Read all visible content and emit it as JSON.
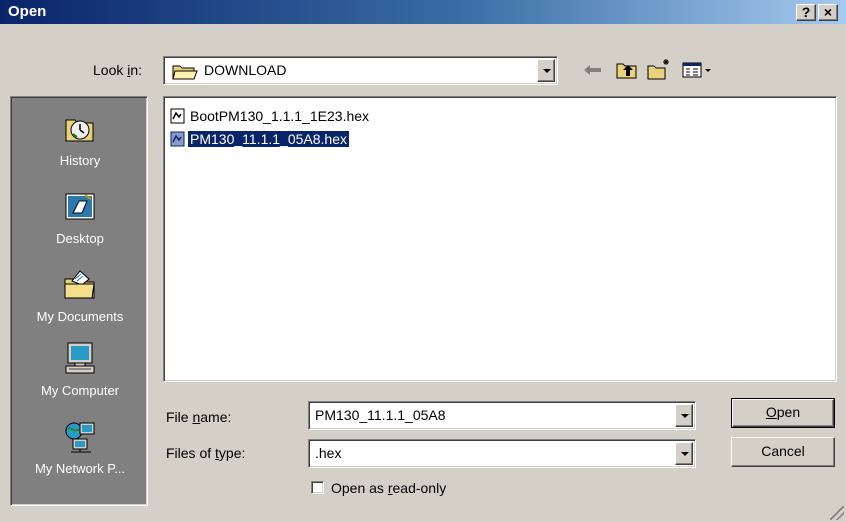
{
  "window": {
    "title": "Open",
    "help_label": "?",
    "close_label": "×"
  },
  "look_in": {
    "label_pre": "Look ",
    "label_u": "i",
    "label_post": "n:",
    "value": "DOWNLOAD"
  },
  "toolbar": {
    "icons": [
      "back-arrow-icon",
      "up-one-level-icon",
      "new-folder-icon",
      "view-menu-icon"
    ]
  },
  "places": [
    {
      "label": "History",
      "icon": "history-icon"
    },
    {
      "label": "Desktop",
      "icon": "desktop-icon"
    },
    {
      "label": "My Documents",
      "icon": "my-documents-icon"
    },
    {
      "label": "My Computer",
      "icon": "my-computer-icon"
    },
    {
      "label": "My Network P...",
      "icon": "my-network-places-icon"
    }
  ],
  "files": [
    {
      "name": "BootPM130_1.1.1_1E23.hex",
      "selected": false
    },
    {
      "name": "PM130_11.1.1_05A8.hex",
      "selected": true
    }
  ],
  "file_name": {
    "label_pre": "File ",
    "label_u": "n",
    "label_post": "ame:",
    "value": "PM130_11.1.1_05A8"
  },
  "file_type": {
    "label_pre": "Files of ",
    "label_u": "t",
    "label_post": "ype:",
    "value": ".hex"
  },
  "read_only": {
    "label_pre": "Open as ",
    "label_u": "r",
    "label_post": "ead-only",
    "checked": false
  },
  "buttons": {
    "open_u": "O",
    "open_rest": "pen",
    "cancel": "Cancel"
  },
  "colors": {
    "title_bar": "#0a246a",
    "selection": "#0a246a",
    "places_bar": "#808080",
    "face": "#d4d0c8"
  }
}
